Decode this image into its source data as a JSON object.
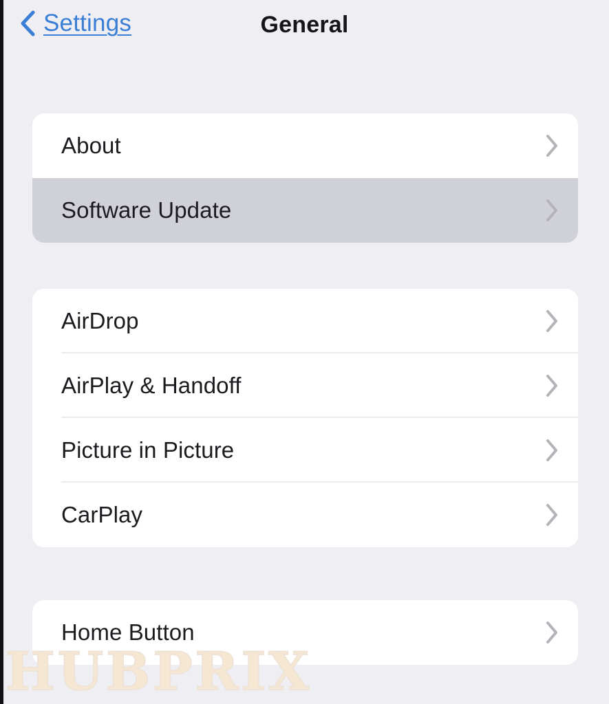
{
  "nav": {
    "back_label": "Settings",
    "back_icon": "chevron-left-icon",
    "title": "General",
    "accent_color": "#3a7fd5"
  },
  "colors": {
    "page_background": "#eeeef3",
    "card_background": "#ffffff",
    "row_highlight": "#d0d0d8",
    "separator": "#ececef",
    "chevron": "#b3b3b8",
    "label_text": "#1b1b1f",
    "watermark": "#f6e7d2"
  },
  "groups": [
    {
      "id": "system-group",
      "rows": [
        {
          "label": "About",
          "chevron": "chevron-right-icon",
          "highlighted": false,
          "separator": false
        },
        {
          "label": "Software Update",
          "chevron": "chevron-right-icon",
          "highlighted": true,
          "separator": false
        }
      ]
    },
    {
      "id": "sharing-group",
      "rows": [
        {
          "label": "AirDrop",
          "chevron": "chevron-right-icon",
          "highlighted": false,
          "separator": true
        },
        {
          "label": "AirPlay & Handoff",
          "chevron": "chevron-right-icon",
          "highlighted": false,
          "separator": true
        },
        {
          "label": "Picture in Picture",
          "chevron": "chevron-right-icon",
          "highlighted": false,
          "separator": true
        },
        {
          "label": "CarPlay",
          "chevron": "chevron-right-icon",
          "highlighted": false,
          "separator": false
        }
      ]
    },
    {
      "id": "hardware-group",
      "rows": [
        {
          "label": "Home Button",
          "chevron": "chevron-right-icon",
          "highlighted": false,
          "separator": false
        }
      ]
    }
  ],
  "watermark": {
    "text": "HUBPRIX"
  }
}
